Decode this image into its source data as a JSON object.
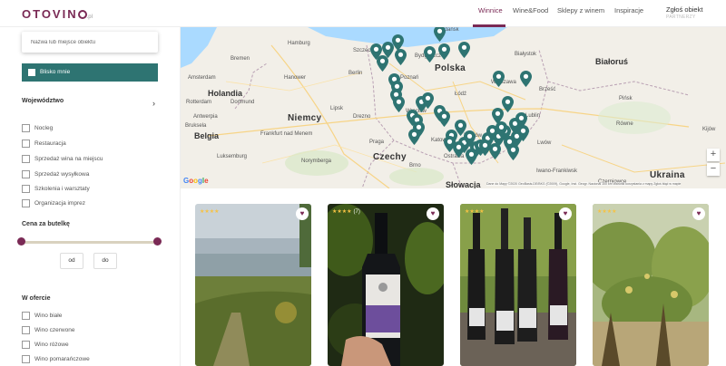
{
  "header": {
    "logo": {
      "pre": "OTOVIN",
      "domain": ".pl"
    },
    "nav": [
      {
        "label": "Winnice",
        "active": true
      },
      {
        "label": "Wine&Food",
        "active": false
      },
      {
        "label": "Sklepy z winem",
        "active": false
      },
      {
        "label": "Inspiracje",
        "active": false
      }
    ],
    "login": {
      "label": "Zgłoś obiekt",
      "sublabel": "PARTNERZY"
    }
  },
  "sidebar": {
    "search_placeholder": "Nazwa lub miejsce obiektu",
    "near_me_label": "Blisko mnie",
    "region_title": "Województwo",
    "categories": [
      "Nocleg",
      "Restauracja",
      "Sprzedaż wina na miejscu",
      "Sprzedaż wysyłkowa",
      "Szkolenia i warsztaty",
      "Organizacja imprez"
    ],
    "price_title": "Cena za butelkę",
    "price_slider": {
      "min_fraction": 0.0,
      "max_fraction": 1.0
    },
    "price_from": "od",
    "price_to": "do",
    "offer_title": "W ofercie",
    "offer_items": [
      "Wino białe",
      "Wino czerwone",
      "Wino różowe",
      "Wino pomarańczowe"
    ]
  },
  "map": {
    "countries": [
      "Polska",
      "Niemcy",
      "Czechy",
      "Białoruś",
      "Ukraina",
      "Holandia",
      "Belgia",
      "Słowacja"
    ],
    "cities": [
      "Gdańsk",
      "Hamburg",
      "Szczecin",
      "Bydgoszcz",
      "Białystok",
      "Bremen",
      "Berlin",
      "Poznań",
      "Warszawa",
      "Amsterdam",
      "Hanower",
      "Łódź",
      "Brześć",
      "Pińsk",
      "Rotterdam",
      "Dortmund",
      "Lipsk",
      "Wrocław",
      "Lublin",
      "Antwerpia",
      "Bruksela",
      "Drezno",
      "Lwów",
      "Równe",
      "Frankfurt nad Menem",
      "Praga",
      "Kraków",
      "Katowice",
      "Ostrawa",
      "Luksemburg",
      "Norymberga",
      "Brno",
      "Iwano-Frankiwsk",
      "Kijów",
      "Czerniowce"
    ],
    "google": [
      "G",
      "o",
      "o",
      "g",
      "l",
      "e"
    ],
    "attribution": "Dane do Mapy ©2020 GeoBasis-DE/BKG (©2009), Google, Inst. Geogr. Nacional   100 km   Warunki korzystania z mapy   Zgłoś błąd w mapie",
    "zoom_in": "+",
    "zoom_out": "−",
    "pin_color": "#2e7472"
  },
  "cards": [
    {
      "stars": "★★★★",
      "count": "",
      "heart": "♥"
    },
    {
      "stars": "★★★★",
      "count": "(7)",
      "heart": "♥"
    },
    {
      "stars": "★★★★",
      "count": "",
      "heart": "♥"
    },
    {
      "stars": "★★★★",
      "count": "",
      "heart": "♥"
    }
  ],
  "colors": {
    "brand": "#7a2a55",
    "accent": "#2e7472",
    "slider_track": "#d9d2bf"
  }
}
